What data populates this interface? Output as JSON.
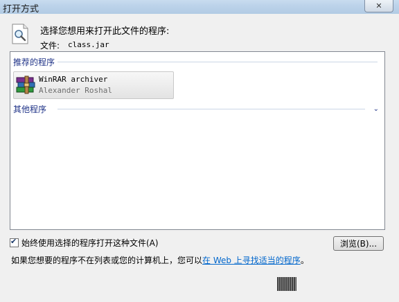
{
  "window": {
    "title": "打开方式",
    "close_glyph": "✕"
  },
  "header": {
    "prompt": "选择您想用来打开此文件的程序:",
    "file_label": "文件:",
    "file_name": "class.jar"
  },
  "groups": {
    "recommended": "推荐的程序",
    "other": "其他程序"
  },
  "programs": [
    {
      "name": "WinRAR archiver",
      "publisher": "Alexander Roshal",
      "icon": "winrar-icon"
    }
  ],
  "expand_glyph": "⌄",
  "options": {
    "always_use_label": "始终使用选择的程序打开这种文件(A)",
    "always_use_checked": true,
    "check_glyph": "✔"
  },
  "buttons": {
    "browse": "浏览(B)..."
  },
  "footer": {
    "text_before": "如果您想要的程序不在列表或您的计算机上，您可以",
    "link_text": "在 Web 上寻找适当的程序",
    "text_after": "。"
  }
}
